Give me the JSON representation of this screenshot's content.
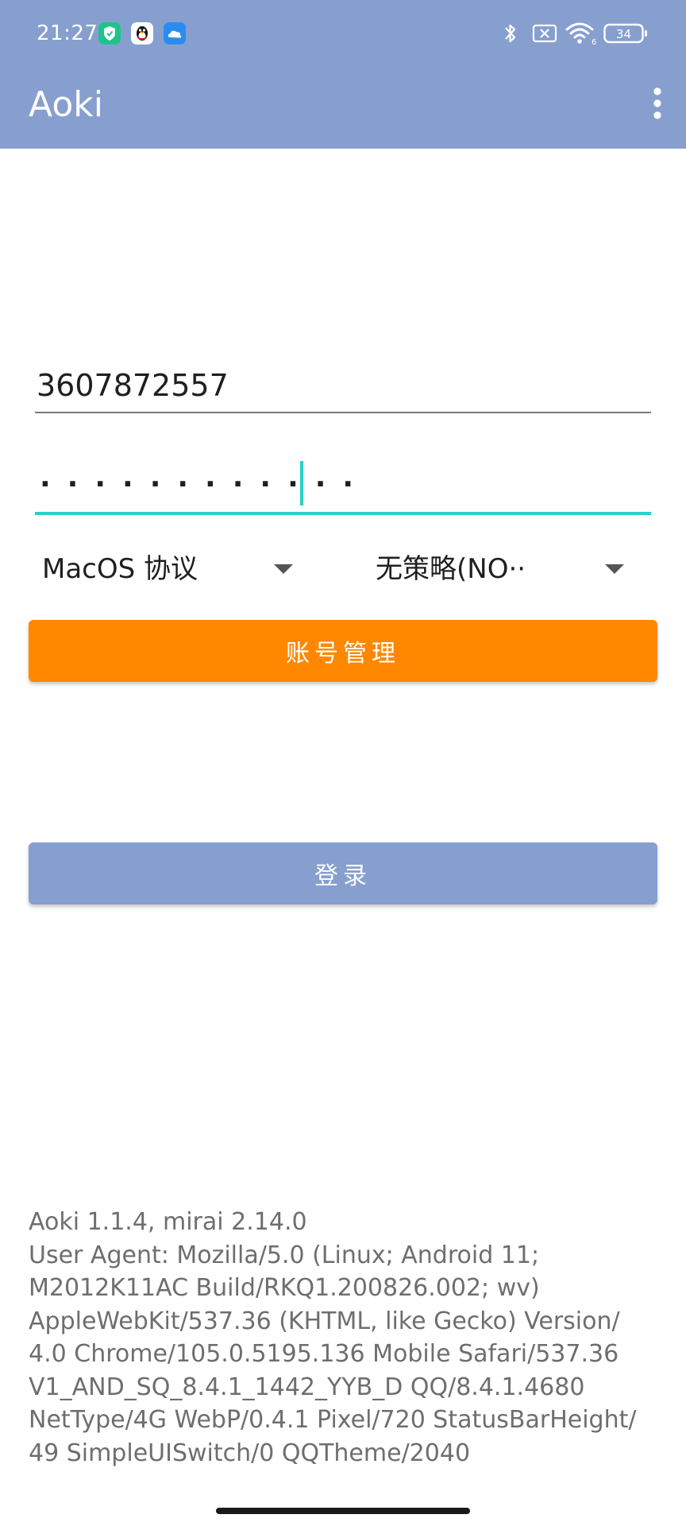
{
  "status_bar": {
    "time": "21:27",
    "battery_level": "34",
    "wifi_badge": "6",
    "notification_icons": [
      "shield-app-icon",
      "qq-penguin-icon",
      "cloud-app-icon"
    ],
    "system_icons": [
      "bluetooth-icon",
      "no-sim-icon",
      "wifi-icon",
      "battery-icon"
    ]
  },
  "toolbar": {
    "title": "Aoki",
    "menu_icon": "more-vertical-icon"
  },
  "form": {
    "account_value": "3607872557",
    "password_mask": "············",
    "protocol_selected": "MacOS 协议",
    "strategy_selected": "无策略(NO··",
    "account_manage_label": "账号管理",
    "login_label": "登录"
  },
  "info": {
    "lines": [
      "Aoki 1.1.4, mirai 2.14.0",
      "User Agent: Mozilla/5.0 (Linux; Android 11;",
      "M2012K11AC Build/RKQ1.200826.002; wv)",
      "AppleWebKit/537.36 (KHTML, like Gecko) Version/",
      "4.0 Chrome/105.0.5195.136 Mobile Safari/537.36",
      "V1_AND_SQ_8.4.1_1442_YYB_D QQ/8.4.1.4680",
      "NetType/4G WebP/0.4.1 Pixel/720 StatusBarHeight/",
      "49 SimpleUISwitch/0 QQTheme/2040"
    ]
  },
  "colors": {
    "primary": "#869fcf",
    "accent": "#ff8800",
    "focus": "#2ccfc8"
  }
}
